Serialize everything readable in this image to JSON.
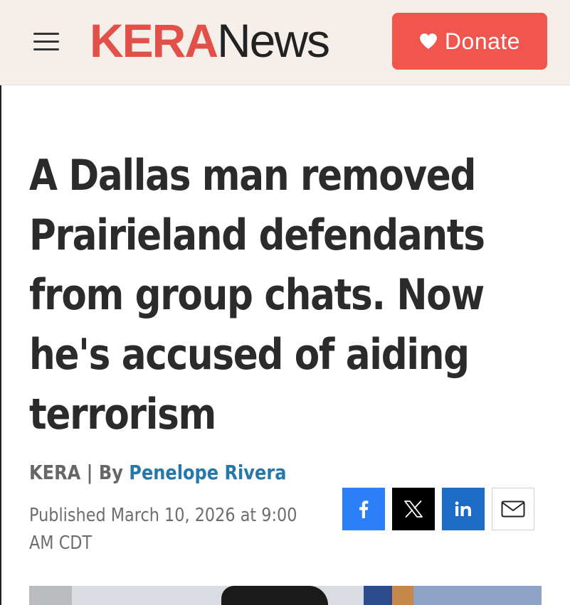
{
  "header": {
    "logo": {
      "part1": "KERA",
      "part2": "News"
    },
    "donate_label": "Donate",
    "colors": {
      "background": "#f6efe9",
      "brand": "#e2504a",
      "donate": "#f0554e"
    }
  },
  "article": {
    "headline": "A Dallas man removed Prairieland defendants from group chats. Now he's accused of aiding terrorism",
    "byline": {
      "source": "KERA",
      "separator": "|",
      "by": "By",
      "author": "Penelope Rivera"
    },
    "published": "Published March 10, 2026 at 9:00 AM CDT"
  },
  "share": [
    {
      "name": "facebook",
      "icon": "facebook-icon",
      "color": "#2d7ff9"
    },
    {
      "name": "x",
      "icon": "x-icon",
      "color": "#000000"
    },
    {
      "name": "linkedin",
      "icon": "linkedin-icon",
      "color": "#1c6bc7"
    },
    {
      "name": "email",
      "icon": "mail-icon",
      "color": "#ffffff"
    }
  ]
}
